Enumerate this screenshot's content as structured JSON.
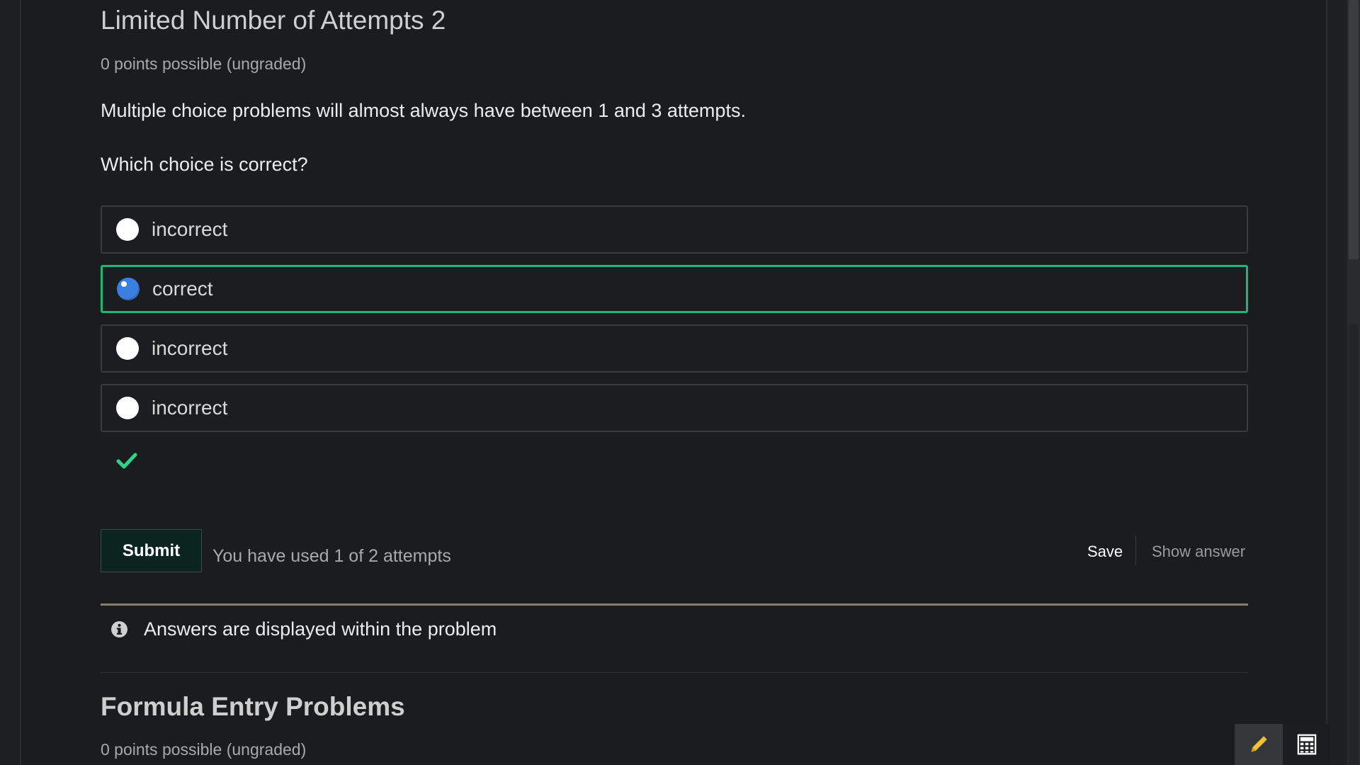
{
  "problem": {
    "title": "Limited Number of Attempts 2",
    "points": "0 points possible (ungraded)",
    "prompt": "Multiple choice problems will almost always have between 1 and 3 attempts.",
    "question": "Which choice is correct?",
    "choices": [
      {
        "label": "incorrect",
        "selected": false
      },
      {
        "label": "correct",
        "selected": true
      },
      {
        "label": "incorrect",
        "selected": false
      },
      {
        "label": "incorrect",
        "selected": false
      }
    ],
    "status_icon": "checkmark-icon",
    "submit_label": "Submit",
    "attempts_text": "You have used 1 of 2 attempts",
    "save_label": "Save",
    "show_answer_label": "Show answer",
    "notification": "Answers are displayed within the problem"
  },
  "next_problem": {
    "title": "Formula Entry Problems",
    "points": "0 points possible (ungraded)"
  },
  "tools": {
    "notes_icon": "pencil-icon",
    "calculator_icon": "calculator-icon"
  },
  "colors": {
    "background": "#1b1c1e",
    "selected_border": "#1fb57a",
    "radio_checked": "#3b7fe0",
    "checkmark": "#2fd38a",
    "submit_bg": "#0b2420",
    "notes_icon": "#f1c232"
  }
}
